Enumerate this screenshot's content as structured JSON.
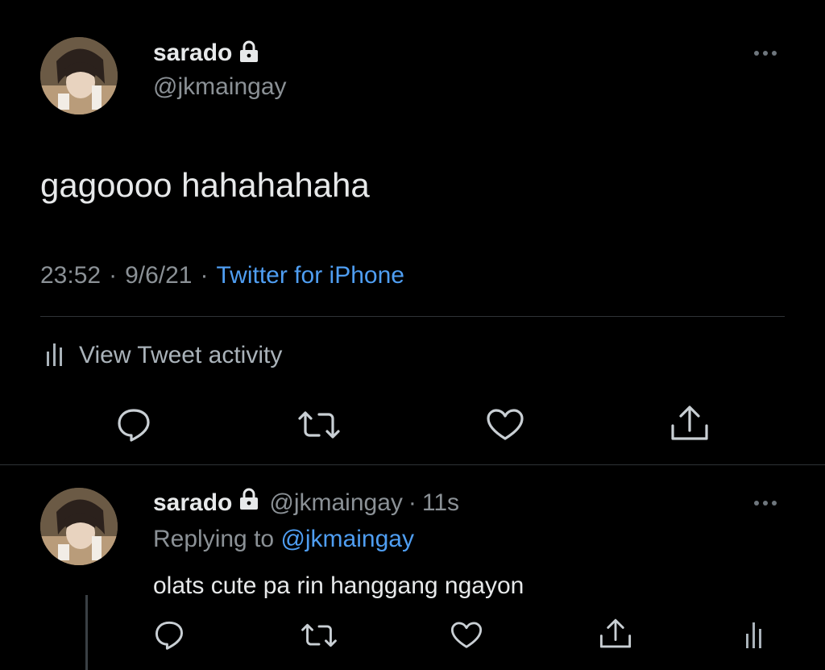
{
  "main_tweet": {
    "display_name": "sarado",
    "handle": "@jkmaingay",
    "text": "gagoooo hahahahaha",
    "time": "23:52",
    "date": "9/6/21",
    "source": "Twitter for iPhone",
    "activity_label": "View Tweet activity"
  },
  "reply": {
    "display_name": "sarado",
    "handle": "@jkmaingay",
    "age": "11s",
    "replying_prefix": "Replying to",
    "replying_to": "@jkmaingay",
    "text": "olats cute pa rin hanggang ngayon"
  },
  "separators": {
    "dot": "·"
  },
  "icons": [
    "lock-icon",
    "more-icon",
    "activity-icon",
    "reply-icon",
    "retweet-icon",
    "like-icon",
    "share-icon"
  ],
  "colors": {
    "background": "#000000",
    "text": "#e7e9ea",
    "secondary": "#8b9196",
    "link": "#4f9ef2"
  }
}
